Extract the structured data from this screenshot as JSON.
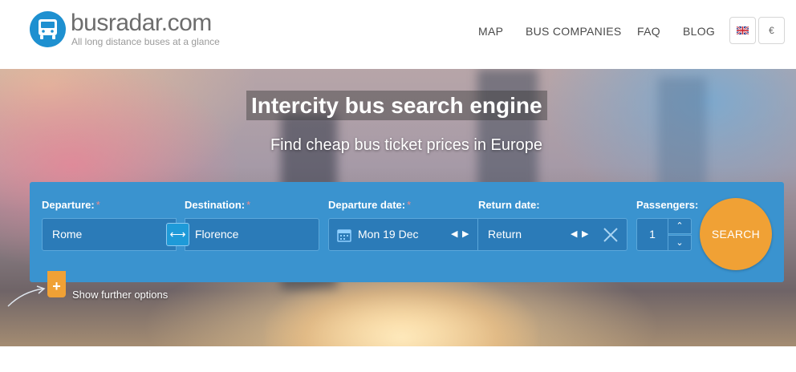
{
  "header": {
    "logo_text": "busradar.com",
    "tagline": "All long distance buses at a glance",
    "nav": {
      "map": "MAP",
      "bus_companies": "BUS COMPANIES",
      "faq": "FAQ",
      "blog": "BLOG"
    },
    "language_icon": "uk-flag-icon",
    "currency": "€"
  },
  "hero": {
    "title": "Intercity bus search engine",
    "subtitle": "Find cheap bus ticket prices in Europe"
  },
  "search": {
    "departure": {
      "label": "Departure:",
      "required": "*",
      "value": "Rome"
    },
    "destination": {
      "label": "Destination:",
      "required": "*",
      "value": "Florence"
    },
    "swap_icon": "swap-arrows-icon",
    "departure_date": {
      "label": "Departure date:",
      "required": "*",
      "value": "Mon 19 Dec"
    },
    "return_date": {
      "label": "Return date:",
      "value": "Return"
    },
    "passengers": {
      "label": "Passengers:",
      "value": "1"
    },
    "search_button": "SEARCH",
    "further_options": "Show further options"
  },
  "colors": {
    "panel": "#3a93cf",
    "field": "#2b7bb8",
    "accent_orange": "#f0a135",
    "logo_blue": "#1e90d0"
  }
}
